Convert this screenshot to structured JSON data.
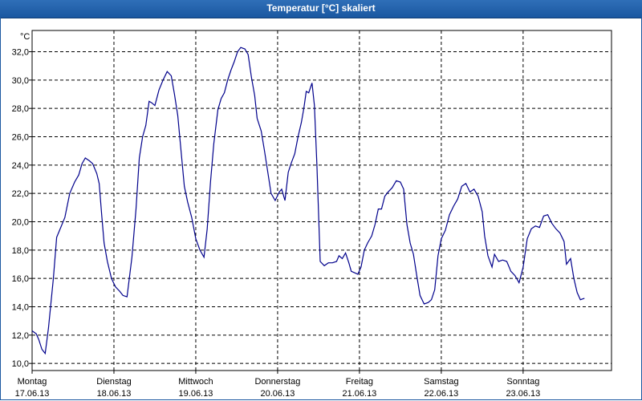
{
  "window": {
    "title": "Temperatur [°C] skaliert"
  },
  "chart_data": {
    "type": "line",
    "unit": "°C",
    "y_ticks": [
      "32,0",
      "30,0",
      "28,0",
      "26,0",
      "24,0",
      "22,0",
      "20,0",
      "18,0",
      "16,0",
      "14,0",
      "12,0",
      "10,0"
    ],
    "ylim": [
      9.5,
      33.5
    ],
    "xlim": [
      0,
      7.08
    ],
    "grid": true,
    "days": [
      {
        "name": "Montag",
        "date": "17.06.13"
      },
      {
        "name": "Dienstag",
        "date": "18.06.13"
      },
      {
        "name": "Mittwoch",
        "date": "19.06.13"
      },
      {
        "name": "Donnerstag",
        "date": "20.06.13"
      },
      {
        "name": "Freitag",
        "date": "21.06.13"
      },
      {
        "name": "Samstag",
        "date": "22.06.13"
      },
      {
        "name": "Sonntag",
        "date": "23.06.13"
      }
    ],
    "colors": {
      "line": "#00008b",
      "grid": "#000000",
      "title_bar": "#1a57a0"
    },
    "series": [
      {
        "values": [
          [
            0.0,
            12.3
          ],
          [
            0.05,
            12.1
          ],
          [
            0.08,
            11.7
          ],
          [
            0.12,
            11.0
          ],
          [
            0.16,
            10.7
          ],
          [
            0.2,
            12.5
          ],
          [
            0.26,
            16.0
          ],
          [
            0.3,
            18.9
          ],
          [
            0.35,
            19.6
          ],
          [
            0.4,
            20.3
          ],
          [
            0.46,
            22.0
          ],
          [
            0.52,
            22.8
          ],
          [
            0.57,
            23.3
          ],
          [
            0.61,
            24.1
          ],
          [
            0.65,
            24.5
          ],
          [
            0.7,
            24.3
          ],
          [
            0.74,
            24.1
          ],
          [
            0.79,
            23.4
          ],
          [
            0.82,
            22.7
          ],
          [
            0.85,
            20.5
          ],
          [
            0.88,
            18.5
          ],
          [
            0.92,
            17.2
          ],
          [
            0.97,
            16.0
          ],
          [
            1.02,
            15.4
          ],
          [
            1.07,
            15.1
          ],
          [
            1.11,
            14.8
          ],
          [
            1.16,
            14.7
          ],
          [
            1.22,
            17.5
          ],
          [
            1.27,
            20.9
          ],
          [
            1.31,
            24.5
          ],
          [
            1.35,
            26.0
          ],
          [
            1.39,
            26.8
          ],
          [
            1.43,
            28.5
          ],
          [
            1.46,
            28.4
          ],
          [
            1.5,
            28.2
          ],
          [
            1.55,
            29.3
          ],
          [
            1.6,
            30.0
          ],
          [
            1.65,
            30.6
          ],
          [
            1.7,
            30.3
          ],
          [
            1.74,
            29.0
          ],
          [
            1.78,
            27.5
          ],
          [
            1.82,
            25.0
          ],
          [
            1.86,
            22.5
          ],
          [
            1.9,
            21.4
          ],
          [
            1.95,
            20.3
          ],
          [
            2.0,
            18.8
          ],
          [
            2.05,
            18.0
          ],
          [
            2.1,
            17.5
          ],
          [
            2.14,
            19.5
          ],
          [
            2.18,
            22.8
          ],
          [
            2.22,
            25.5
          ],
          [
            2.27,
            27.9
          ],
          [
            2.31,
            28.7
          ],
          [
            2.35,
            29.1
          ],
          [
            2.39,
            30.0
          ],
          [
            2.43,
            30.7
          ],
          [
            2.47,
            31.3
          ],
          [
            2.51,
            32.0
          ],
          [
            2.55,
            32.3
          ],
          [
            2.6,
            32.2
          ],
          [
            2.64,
            31.8
          ],
          [
            2.68,
            30.2
          ],
          [
            2.72,
            28.9
          ],
          [
            2.75,
            27.3
          ],
          [
            2.8,
            26.4
          ],
          [
            2.84,
            25.0
          ],
          [
            2.88,
            23.5
          ],
          [
            2.92,
            22.0
          ],
          [
            2.97,
            21.5
          ],
          [
            3.02,
            22.1
          ],
          [
            3.05,
            22.3
          ],
          [
            3.09,
            21.5
          ],
          [
            3.13,
            23.5
          ],
          [
            3.17,
            24.2
          ],
          [
            3.21,
            24.8
          ],
          [
            3.25,
            26.0
          ],
          [
            3.29,
            27.0
          ],
          [
            3.32,
            28.0
          ],
          [
            3.35,
            29.2
          ],
          [
            3.38,
            29.1
          ],
          [
            3.42,
            29.8
          ],
          [
            3.45,
            28.2
          ],
          [
            3.48,
            24.0
          ],
          [
            3.52,
            17.2
          ],
          [
            3.57,
            16.9
          ],
          [
            3.62,
            17.1
          ],
          [
            3.67,
            17.1
          ],
          [
            3.72,
            17.2
          ],
          [
            3.75,
            17.6
          ],
          [
            3.79,
            17.4
          ],
          [
            3.83,
            17.8
          ],
          [
            3.87,
            17.1
          ],
          [
            3.9,
            16.5
          ],
          [
            3.94,
            16.4
          ],
          [
            3.98,
            16.3
          ],
          [
            4.02,
            16.8
          ],
          [
            4.06,
            18.0
          ],
          [
            4.1,
            18.5
          ],
          [
            4.15,
            19.0
          ],
          [
            4.19,
            19.8
          ],
          [
            4.23,
            20.9
          ],
          [
            4.27,
            20.9
          ],
          [
            4.31,
            21.8
          ],
          [
            4.35,
            22.1
          ],
          [
            4.4,
            22.4
          ],
          [
            4.45,
            22.9
          ],
          [
            4.5,
            22.8
          ],
          [
            4.54,
            22.3
          ],
          [
            4.58,
            19.8
          ],
          [
            4.62,
            18.5
          ],
          [
            4.66,
            17.7
          ],
          [
            4.7,
            16.2
          ],
          [
            4.74,
            14.8
          ],
          [
            4.79,
            14.2
          ],
          [
            4.84,
            14.3
          ],
          [
            4.88,
            14.5
          ],
          [
            4.92,
            15.2
          ],
          [
            4.96,
            17.6
          ],
          [
            5.0,
            18.8
          ],
          [
            5.05,
            19.4
          ],
          [
            5.1,
            20.5
          ],
          [
            5.15,
            21.1
          ],
          [
            5.2,
            21.6
          ],
          [
            5.25,
            22.5
          ],
          [
            5.3,
            22.7
          ],
          [
            5.35,
            22.1
          ],
          [
            5.4,
            22.3
          ],
          [
            5.45,
            21.8
          ],
          [
            5.5,
            20.7
          ],
          [
            5.53,
            19.0
          ],
          [
            5.57,
            17.6
          ],
          [
            5.62,
            16.8
          ],
          [
            5.65,
            17.7
          ],
          [
            5.7,
            17.2
          ],
          [
            5.75,
            17.3
          ],
          [
            5.8,
            17.2
          ],
          [
            5.85,
            16.5
          ],
          [
            5.9,
            16.2
          ],
          [
            5.95,
            15.7
          ],
          [
            6.0,
            16.8
          ],
          [
            6.05,
            18.8
          ],
          [
            6.1,
            19.5
          ],
          [
            6.15,
            19.7
          ],
          [
            6.2,
            19.6
          ],
          [
            6.25,
            20.4
          ],
          [
            6.3,
            20.5
          ],
          [
            6.35,
            19.9
          ],
          [
            6.4,
            19.5
          ],
          [
            6.45,
            19.2
          ],
          [
            6.5,
            18.6
          ],
          [
            6.53,
            17.0
          ],
          [
            6.58,
            17.4
          ],
          [
            6.62,
            16.0
          ],
          [
            6.66,
            15.0
          ],
          [
            6.7,
            14.5
          ],
          [
            6.75,
            14.6
          ]
        ]
      }
    ]
  }
}
